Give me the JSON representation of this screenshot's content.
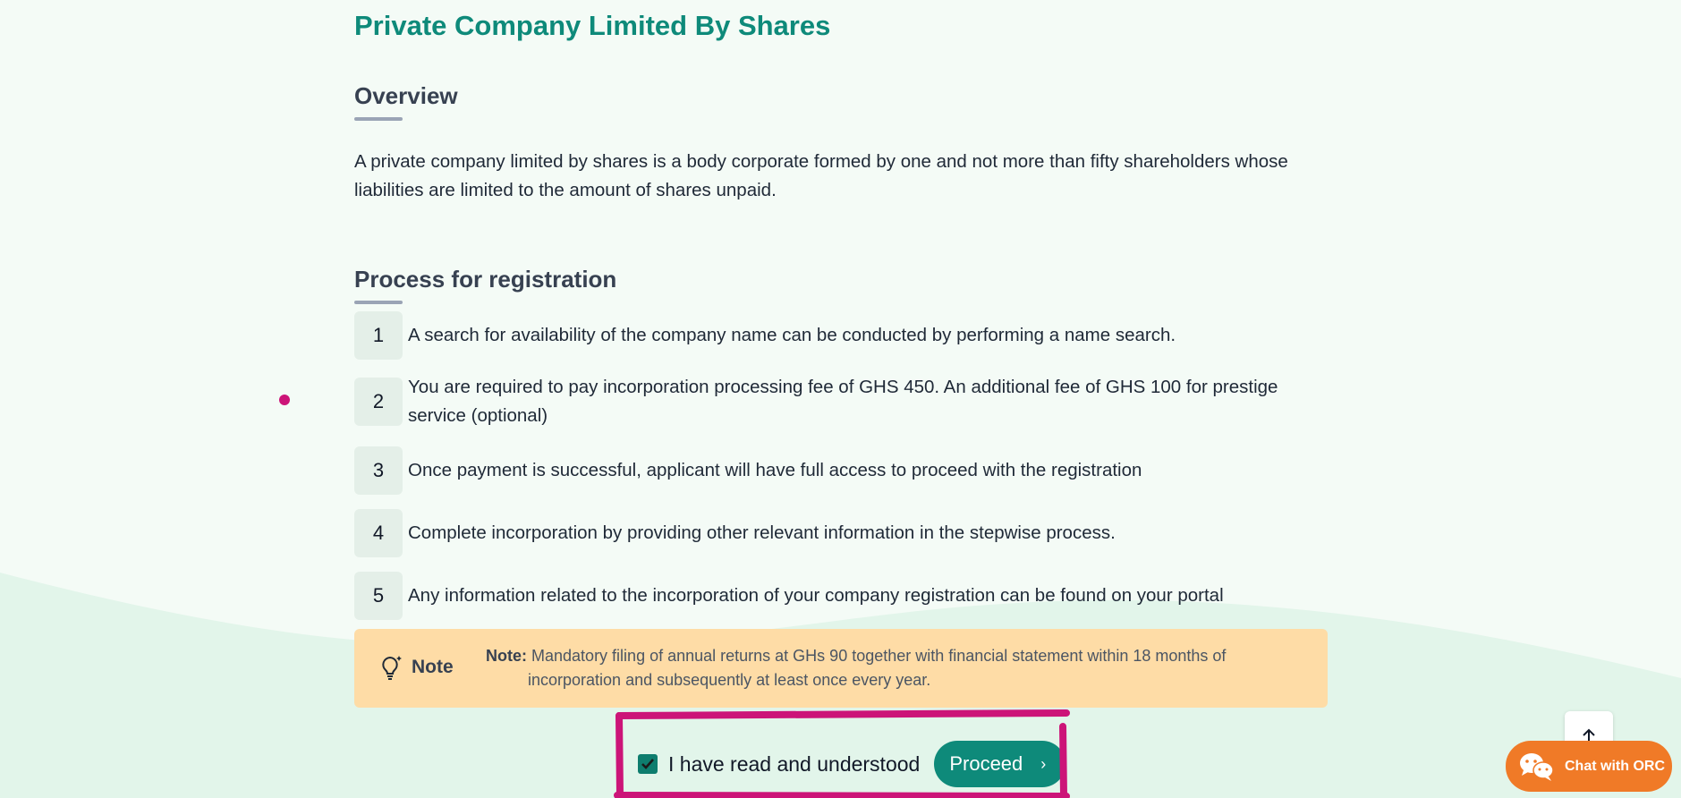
{
  "page": {
    "title": "Private Company Limited By Shares",
    "accent_color": "#0e8a7a"
  },
  "overview": {
    "heading": "Overview",
    "text": "A private company limited by shares is a body corporate formed by one and not more than fifty shareholders whose liabilities are limited to the amount of shares unpaid."
  },
  "process": {
    "heading": "Process for registration",
    "steps": [
      {
        "num": "1",
        "text": "A search for availability of the company name can be conducted by performing a name search."
      },
      {
        "num": "2",
        "text": "You are required to pay incorporation processing fee of GHS 450. An additional fee of GHS 100 for prestige service (optional)"
      },
      {
        "num": "3",
        "text": "Once payment is successful, applicant will have full access to proceed with the registration"
      },
      {
        "num": "4",
        "text": "Complete incorporation by providing other relevant information in the stepwise process."
      },
      {
        "num": "5",
        "text": "Any information related to the incorporation of your company registration can be found on your portal"
      }
    ]
  },
  "note": {
    "label": "Note",
    "prefix": "Note:",
    "line1": "Mandatory filing of annual returns at GHs 90 together with financial statement within 18 months of",
    "line2": "incorporation and subsequently at least once every year.",
    "background": "#fedca6",
    "icon": "lightbulb-icon"
  },
  "accept": {
    "checked": true,
    "label": "I have read and understood",
    "button_label": "Proceed",
    "button_icon": "chevron-right-icon"
  },
  "floating": {
    "scroll_top_icon": "arrow-up-icon",
    "chat_label": "Chat with ORC",
    "chat_icon": "wechat-icon",
    "chat_color": "#f07a27"
  },
  "annotation_color": "#cc1478"
}
